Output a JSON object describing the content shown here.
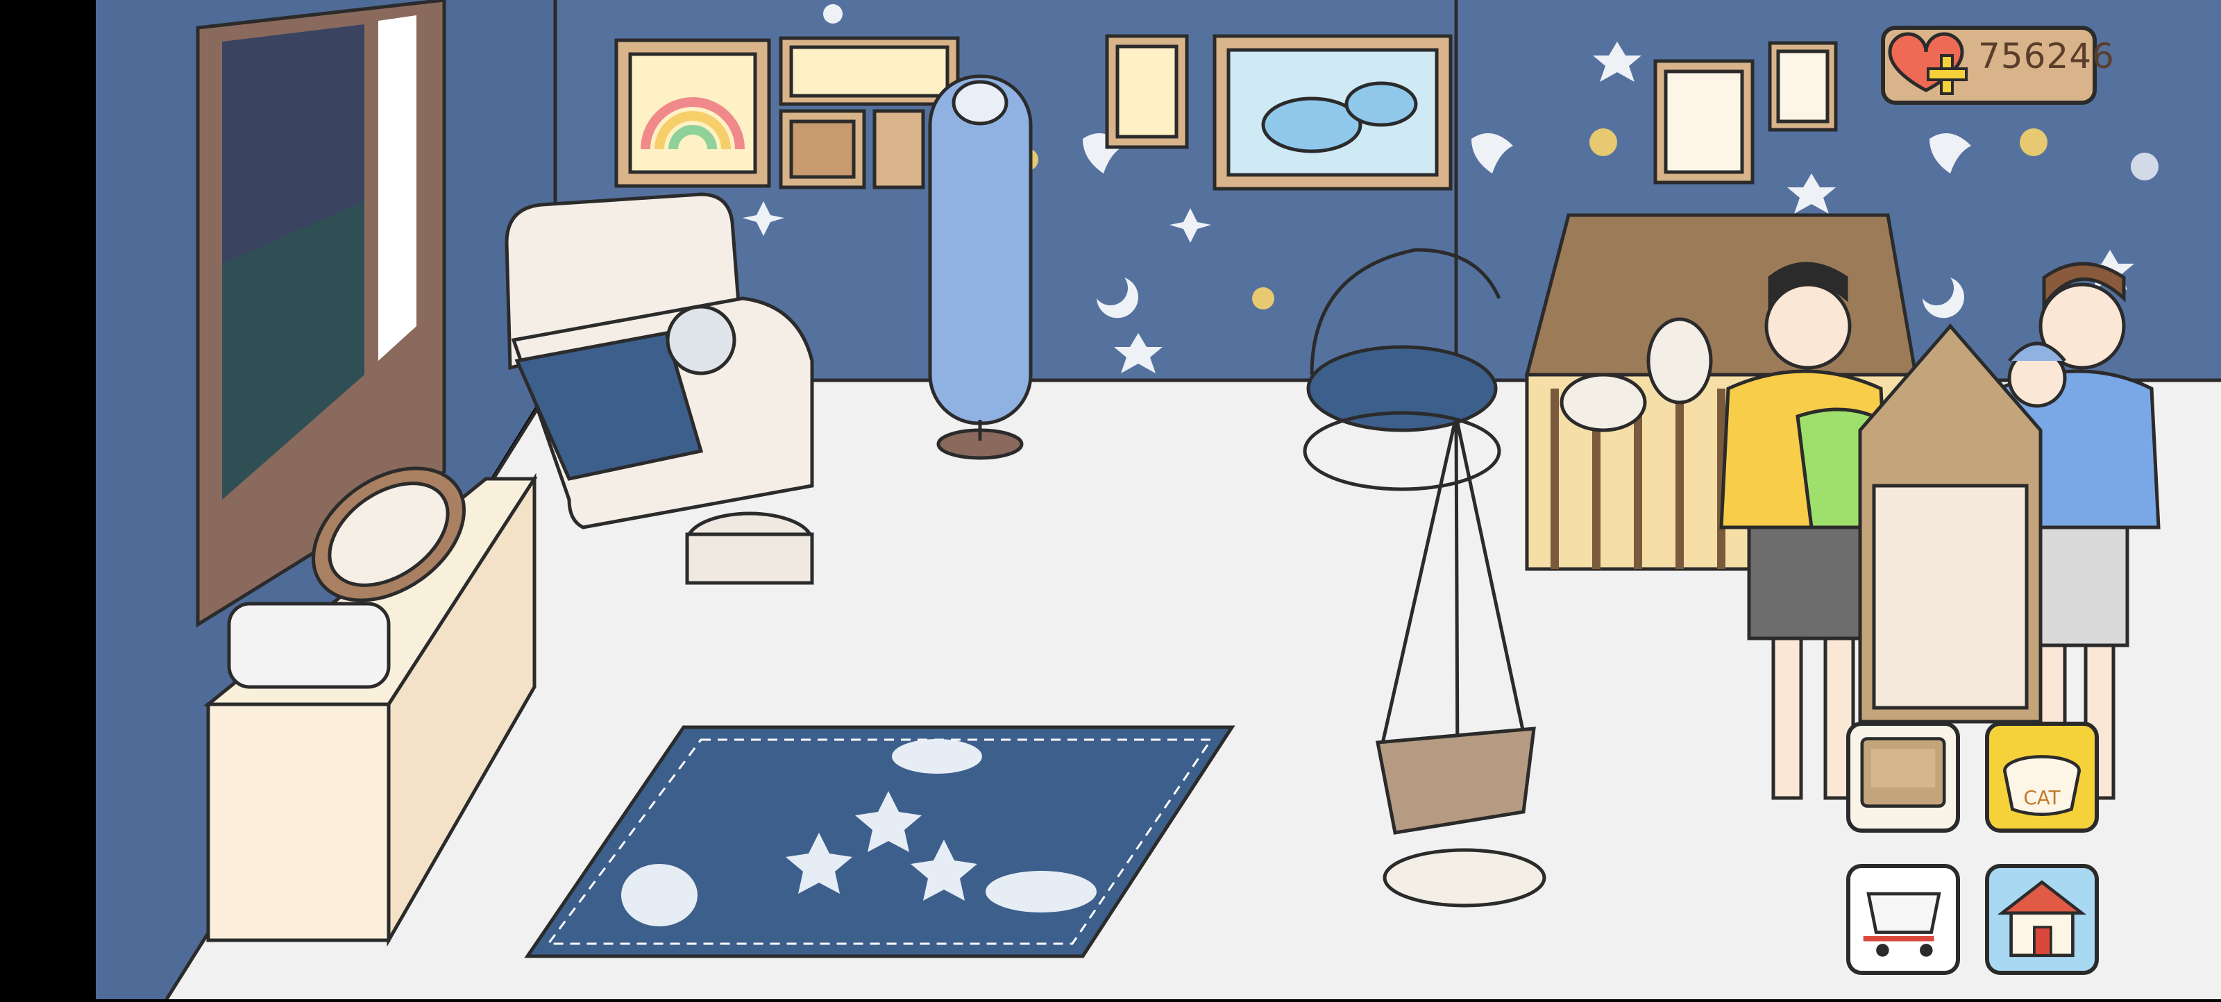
{
  "hud": {
    "currency_value": "756246",
    "currency_icon": "heart-plus-icon"
  },
  "buttons": [
    {
      "name": "box-button",
      "icon": "box-icon"
    },
    {
      "name": "cat-food-button",
      "icon": "cat-bowl-icon",
      "label": "CAT"
    },
    {
      "name": "shop-button",
      "icon": "shopping-cart-icon"
    },
    {
      "name": "home-button",
      "icon": "house-icon"
    }
  ],
  "colors": {
    "wall": "#4f6f9f",
    "floor": "#f1f1f1",
    "rug": "#3d5f8c",
    "accent_gold": "#f0c84a",
    "outline": "#2b2b2b"
  }
}
